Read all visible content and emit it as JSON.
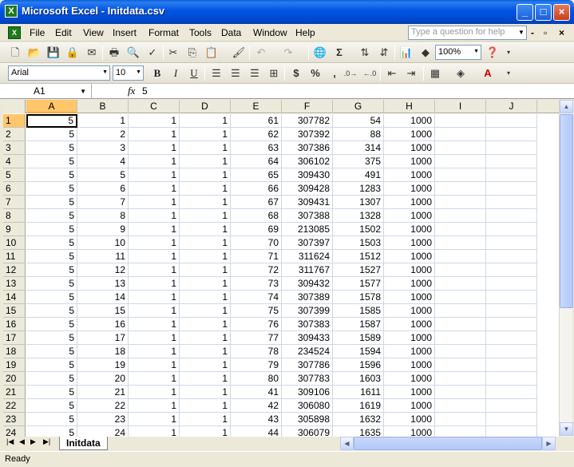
{
  "window": {
    "title": "Microsoft Excel - Initdata.csv",
    "minimize": "_",
    "maximize": "□",
    "close": "×"
  },
  "menubar": {
    "items": [
      "File",
      "Edit",
      "View",
      "Insert",
      "Format",
      "Tools",
      "Data",
      "Window",
      "Help"
    ],
    "question_placeholder": "Type a question for help",
    "mdi_min": "-",
    "mdi_restore": "▫",
    "mdi_close": "×"
  },
  "toolbar": {
    "zoom": "100%",
    "font_name": "Arial",
    "font_size": "10",
    "bold": "B",
    "italic": "I",
    "underline": "U",
    "currency": "$",
    "percent": "%",
    "comma": ",",
    "sum": "Σ"
  },
  "formula_bar": {
    "name_box": "A1",
    "fx": "fx",
    "value": "5"
  },
  "grid": {
    "columns": [
      "A",
      "B",
      "C",
      "D",
      "E",
      "F",
      "G",
      "H",
      "I",
      "J"
    ],
    "rows": [
      [
        "5",
        "1",
        "1",
        "1",
        "61",
        "307782",
        "54",
        "1000",
        "",
        ""
      ],
      [
        "5",
        "2",
        "1",
        "1",
        "62",
        "307392",
        "88",
        "1000",
        "",
        ""
      ],
      [
        "5",
        "3",
        "1",
        "1",
        "63",
        "307386",
        "314",
        "1000",
        "",
        ""
      ],
      [
        "5",
        "4",
        "1",
        "1",
        "64",
        "306102",
        "375",
        "1000",
        "",
        ""
      ],
      [
        "5",
        "5",
        "1",
        "1",
        "65",
        "309430",
        "491",
        "1000",
        "",
        ""
      ],
      [
        "5",
        "6",
        "1",
        "1",
        "66",
        "309428",
        "1283",
        "1000",
        "",
        ""
      ],
      [
        "5",
        "7",
        "1",
        "1",
        "67",
        "309431",
        "1307",
        "1000",
        "",
        ""
      ],
      [
        "5",
        "8",
        "1",
        "1",
        "68",
        "307388",
        "1328",
        "1000",
        "",
        ""
      ],
      [
        "5",
        "9",
        "1",
        "1",
        "69",
        "213085",
        "1502",
        "1000",
        "",
        ""
      ],
      [
        "5",
        "10",
        "1",
        "1",
        "70",
        "307397",
        "1503",
        "1000",
        "",
        ""
      ],
      [
        "5",
        "11",
        "1",
        "1",
        "71",
        "311624",
        "1512",
        "1000",
        "",
        ""
      ],
      [
        "5",
        "12",
        "1",
        "1",
        "72",
        "311767",
        "1527",
        "1000",
        "",
        ""
      ],
      [
        "5",
        "13",
        "1",
        "1",
        "73",
        "309432",
        "1577",
        "1000",
        "",
        ""
      ],
      [
        "5",
        "14",
        "1",
        "1",
        "74",
        "307389",
        "1578",
        "1000",
        "",
        ""
      ],
      [
        "5",
        "15",
        "1",
        "1",
        "75",
        "307399",
        "1585",
        "1000",
        "",
        ""
      ],
      [
        "5",
        "16",
        "1",
        "1",
        "76",
        "307383",
        "1587",
        "1000",
        "",
        ""
      ],
      [
        "5",
        "17",
        "1",
        "1",
        "77",
        "309433",
        "1589",
        "1000",
        "",
        ""
      ],
      [
        "5",
        "18",
        "1",
        "1",
        "78",
        "234524",
        "1594",
        "1000",
        "",
        ""
      ],
      [
        "5",
        "19",
        "1",
        "1",
        "79",
        "307786",
        "1596",
        "1000",
        "",
        ""
      ],
      [
        "5",
        "20",
        "1",
        "1",
        "80",
        "307783",
        "1603",
        "1000",
        "",
        ""
      ],
      [
        "5",
        "21",
        "1",
        "1",
        "41",
        "309106",
        "1611",
        "1000",
        "",
        ""
      ],
      [
        "5",
        "22",
        "1",
        "1",
        "42",
        "306080",
        "1619",
        "1000",
        "",
        ""
      ],
      [
        "5",
        "23",
        "1",
        "1",
        "43",
        "305898",
        "1632",
        "1000",
        "",
        ""
      ],
      [
        "5",
        "24",
        "1",
        "1",
        "44",
        "306079",
        "1635",
        "1000",
        "",
        ""
      ]
    ]
  },
  "sheet_tabs": [
    "Initdata"
  ],
  "status": "Ready"
}
